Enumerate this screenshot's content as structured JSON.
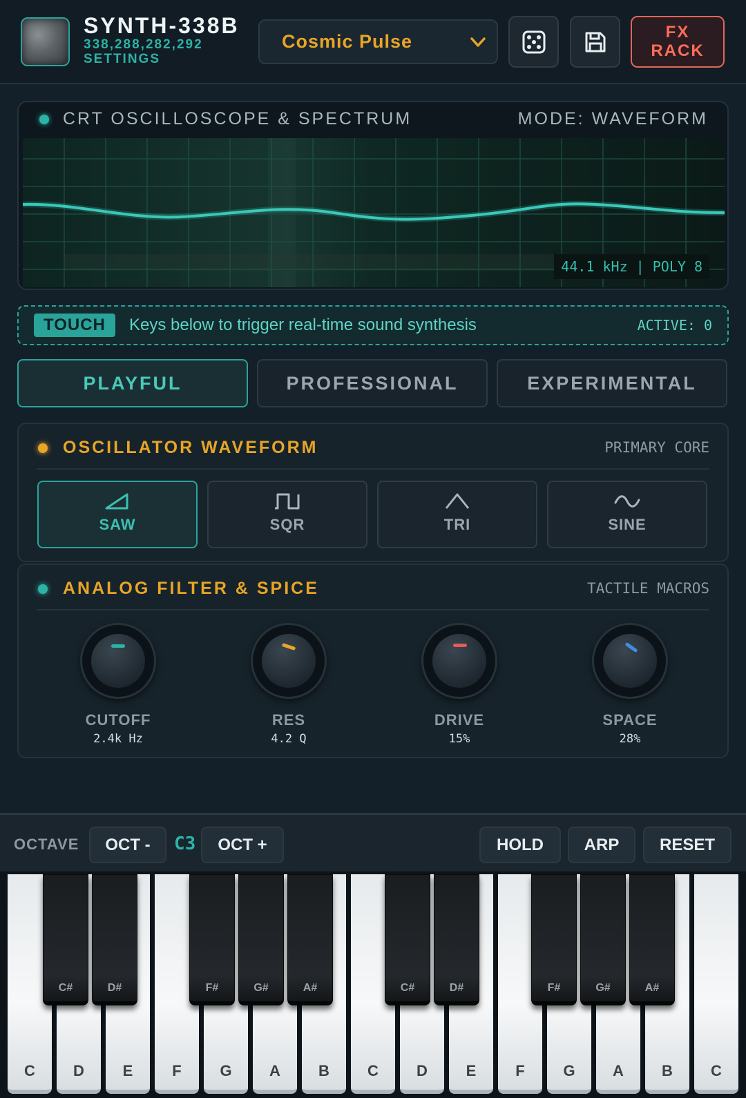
{
  "header": {
    "title": "SYNTH-338B",
    "subtitle_numbers": "338,288,282,292",
    "subtitle_settings": "SETTINGS",
    "preset": "Cosmic Pulse",
    "fx_line1": "FX",
    "fx_line2": "RACK",
    "icons": [
      "dice-icon",
      "save-icon",
      "chevron-down-icon"
    ]
  },
  "scope": {
    "title": "CRT OSCILLOSCOPE & SPECTRUM",
    "mode": "MODE: WAVEFORM",
    "readout": "44.1 kHz | POLY 8"
  },
  "touch": {
    "badge": "TOUCH",
    "text": "Keys below to trigger real-time sound synthesis",
    "active": "ACTIVE: 0"
  },
  "styles": {
    "tabs": [
      {
        "label": "PLAYFUL",
        "active": true
      },
      {
        "label": "PROFESSIONAL",
        "active": false
      },
      {
        "label": "EXPERIMENTAL",
        "active": false
      }
    ]
  },
  "oscillator": {
    "title": "OSCILLATOR WAVEFORM",
    "tag": "PRIMARY CORE",
    "waves": [
      {
        "label": "SAW",
        "icon": "saw-wave-icon",
        "active": true
      },
      {
        "label": "SQR",
        "icon": "square-wave-icon",
        "active": false
      },
      {
        "label": "TRI",
        "icon": "triangle-wave-icon",
        "active": false
      },
      {
        "label": "SINE",
        "icon": "sine-wave-icon",
        "active": false
      }
    ]
  },
  "filter": {
    "title": "ANALOG FILTER & SPICE",
    "tag": "TACTILE MACROS",
    "knobs": [
      {
        "label": "CUTOFF",
        "value": "2.4k Hz",
        "color": "#2bb3a6"
      },
      {
        "label": "RES",
        "value": "4.2 Q",
        "color": "#e8a526"
      },
      {
        "label": "DRIVE",
        "value": "15%",
        "color": "#e25b5b"
      },
      {
        "label": "SPACE",
        "value": "28%",
        "color": "#3f8fe0"
      }
    ]
  },
  "keyboard": {
    "octave_label": "OCTAVE",
    "oct_minus": "OCT -",
    "oct_value": "C3",
    "oct_plus": "OCT +",
    "hold": "HOLD",
    "arp": "ARP",
    "reset": "RESET",
    "white_keys": [
      "C",
      "D",
      "E",
      "F",
      "G",
      "A",
      "B",
      "C",
      "D",
      "E",
      "F",
      "G",
      "A",
      "B",
      "C"
    ],
    "black_keys": [
      "C#",
      "D#",
      "F#",
      "G#",
      "A#",
      "C#",
      "D#",
      "F#",
      "G#",
      "A#"
    ]
  },
  "colors": {
    "accent_teal": "#2aa39a",
    "accent_amber": "#e8a526",
    "accent_red": "#e26758",
    "background": "#142029"
  }
}
